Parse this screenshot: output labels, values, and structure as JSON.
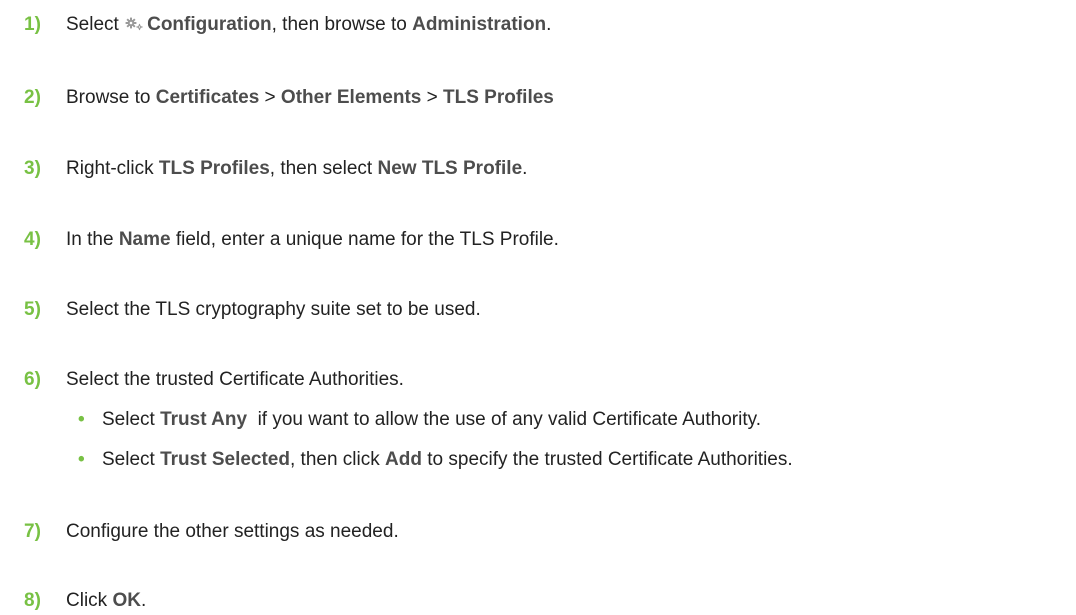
{
  "steps": [
    {
      "num": "1)",
      "a": "Select ",
      "b": "Configuration",
      "c": ", then browse to ",
      "d": "Administration",
      "e": "."
    },
    {
      "num": "2)",
      "a": "Browse to ",
      "b": "Certificates",
      "c": " > ",
      "d": "Other Elements",
      "e": " > ",
      "f": "TLS Profiles"
    },
    {
      "num": "3)",
      "a": "Right-click ",
      "b": "TLS Profiles",
      "c": ", then select ",
      "d": "New TLS Profile",
      "e": "."
    },
    {
      "num": "4)",
      "a": "In the ",
      "b": "Name",
      "c": " field, enter a unique name for the TLS Profile."
    },
    {
      "num": "5)",
      "a": "Select the TLS cryptography suite set to be used."
    },
    {
      "num": "6)",
      "a": "Select the trusted Certificate Authorities."
    },
    {
      "num": "7)",
      "a": "Configure the other settings as needed."
    },
    {
      "num": "8)",
      "a": "Click ",
      "b": "OK",
      "c": "."
    }
  ],
  "sub_bullets": [
    {
      "a": "Select ",
      "b": "Trust Any",
      "c": "  if you want to allow the use of any valid Certificate Authority."
    },
    {
      "a": "Select ",
      "b": "Trust Selected",
      "c": ", then click ",
      "d": "Add",
      "e": " to specify the trusted Certificate Authorities."
    }
  ],
  "bullet_char": "•",
  "colors": {
    "step_number": "#78c144",
    "bold_text": "#4d4d4d",
    "body_text": "#222222"
  },
  "icons": [
    "gear-icon"
  ]
}
